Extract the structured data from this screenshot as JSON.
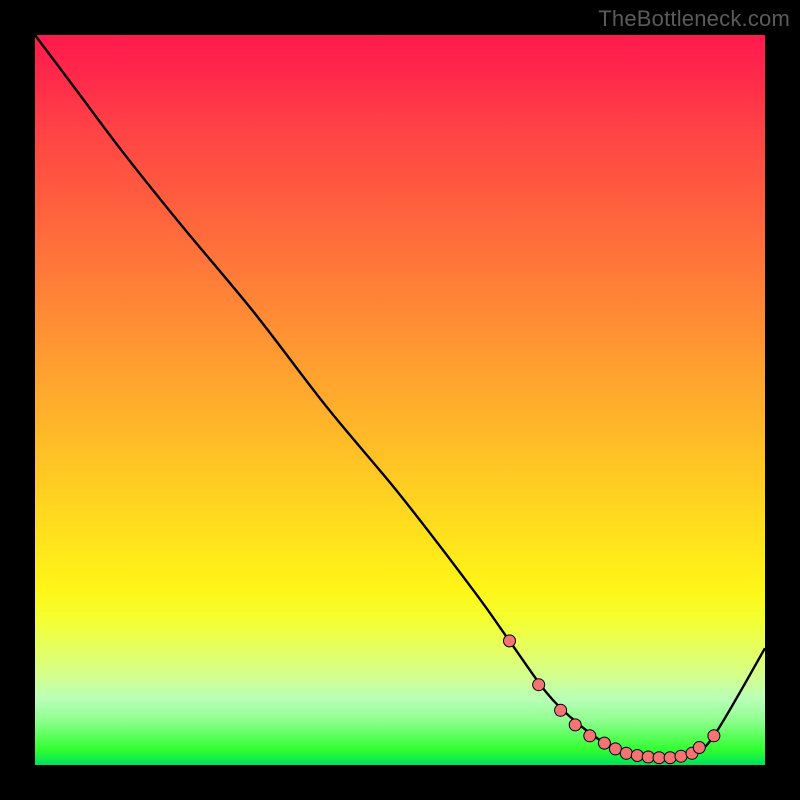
{
  "watermark": "TheBottleneck.com",
  "colors": {
    "curve": "#000000",
    "dot_fill": "#f47373",
    "dot_stroke": "#000000"
  },
  "chart_data": {
    "type": "line",
    "title": "",
    "xlabel": "",
    "ylabel": "",
    "xlim": [
      0,
      100
    ],
    "ylim": [
      0,
      100
    ],
    "grid": false,
    "legend": false,
    "series": [
      {
        "name": "bottleneck-curve",
        "x": [
          0,
          6,
          12,
          20,
          30,
          40,
          50,
          60,
          65,
          70,
          74,
          78,
          81,
          84,
          87,
          90,
          93,
          100
        ],
        "y": [
          100,
          92,
          84,
          74,
          62,
          49,
          37,
          24,
          17,
          10,
          6,
          3,
          1.5,
          1,
          1,
          1.5,
          4,
          16
        ]
      }
    ],
    "markers": {
      "name": "highlight-points",
      "x": [
        65,
        69,
        72,
        74,
        76,
        78,
        79.5,
        81,
        82.5,
        84,
        85.5,
        87,
        88.5,
        90,
        91,
        93
      ],
      "y": [
        17,
        11,
        7.5,
        5.5,
        4,
        3,
        2.2,
        1.6,
        1.3,
        1.1,
        1.0,
        1.0,
        1.2,
        1.6,
        2.4,
        4
      ]
    }
  }
}
